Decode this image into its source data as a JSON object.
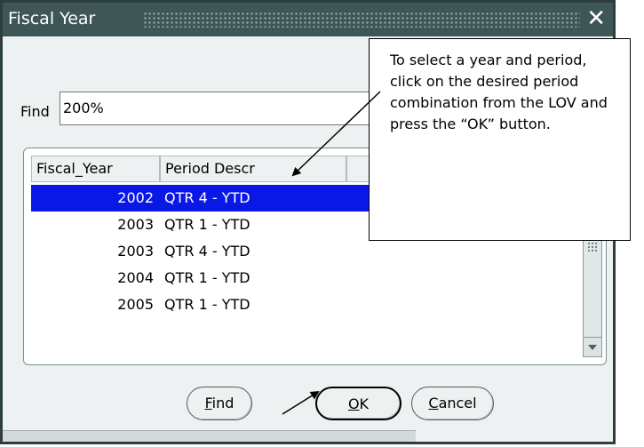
{
  "dialog": {
    "title": "Fiscal Year",
    "close_glyph": "✕"
  },
  "find": {
    "label": "Find",
    "value": "200%"
  },
  "list": {
    "columns": [
      "Fiscal_Year",
      "Period Descr"
    ],
    "rows": [
      {
        "year": "2002",
        "period": "QTR 4 - YTD",
        "selected": true
      },
      {
        "year": "2003",
        "period": "QTR 1 - YTD",
        "selected": false
      },
      {
        "year": "2003",
        "period": "QTR 4 - YTD",
        "selected": false
      },
      {
        "year": "2004",
        "period": "QTR 1 - YTD",
        "selected": false
      },
      {
        "year": "2005",
        "period": "QTR 1 - YTD",
        "selected": false
      }
    ]
  },
  "buttons": {
    "find": {
      "mnemonic": "F",
      "rest": "ind"
    },
    "ok": {
      "mnemonic": "O",
      "rest": "K"
    },
    "cancel": {
      "mnemonic": "C",
      "rest": "ancel"
    }
  },
  "callout": {
    "text": "To select a year and period, click on the desired period combination from the LOV and press the “OK” button."
  },
  "colors": {
    "titlebar": "#3f5656",
    "selection": "#0a18e6",
    "dialog_bg": "#eef1f1"
  }
}
